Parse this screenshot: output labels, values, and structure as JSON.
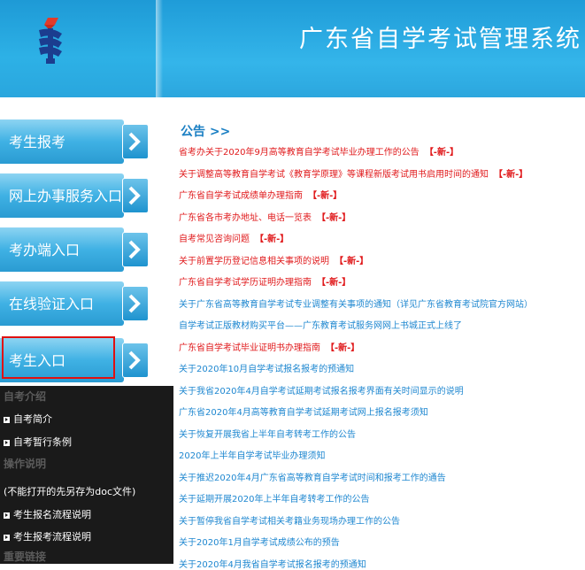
{
  "header": {
    "title": "广东省自学考试管理系统",
    "colors": {
      "bg": "#2aa6dc",
      "text": "#ffffff"
    }
  },
  "sidebar": {
    "buttons": [
      {
        "label": "考生报考"
      },
      {
        "label": "网上办事服务入口"
      },
      {
        "label": "考办端入口"
      },
      {
        "label": "在线验证入口"
      },
      {
        "label": "考生入口",
        "highlighted": true
      }
    ],
    "sections": [
      {
        "heading": "自考介绍",
        "links": [
          "自考简介",
          "自考暂行条例"
        ]
      },
      {
        "heading": "操作说明",
        "note": "(不能打开的先另存为doc文件)",
        "links": [
          "考生报名流程说明",
          "考生报考流程说明"
        ]
      },
      {
        "heading": "重要链接"
      }
    ]
  },
  "notices": {
    "title": "公告 >>",
    "new_tag": "【-新-】",
    "items": [
      {
        "text": "省考办关于2020年9月高等教育自学考试毕业办理工作的公告",
        "color": "red",
        "new": true
      },
      {
        "text": "关于调整高等教育自学考试《教育学原理》等课程新版考试用书启用时间的通知",
        "color": "red",
        "new": true
      },
      {
        "text": "广东省自学考试成绩单办理指南",
        "color": "red",
        "new": true
      },
      {
        "text": "广东省各市考办地址、电话一览表",
        "color": "red",
        "new": true
      },
      {
        "text": "自考常见咨询问题",
        "color": "red",
        "new": true
      },
      {
        "text": "关于前置学历登记信息相关事项的说明",
        "color": "red",
        "new": true
      },
      {
        "text": "广东省自学考试学历证明办理指南",
        "color": "red",
        "new": true
      },
      {
        "text": "关于广东省高等教育自学考试专业调整有关事项的通知（详见广东省教育考试院官方网站）",
        "color": "blue",
        "new": false
      },
      {
        "text": "自学考试正版教材购买平台——广东教育考试服务网网上书城正式上线了",
        "color": "blue",
        "new": false
      },
      {
        "text": "广东省自学考试毕业证明书办理指南",
        "color": "red",
        "new": true
      },
      {
        "text": "关于2020年10月自学考试报名报考的预通知",
        "color": "blue",
        "new": false
      },
      {
        "text": "关于我省2020年4月自学考试延期考试报名报考界面有关时间显示的说明",
        "color": "blue",
        "new": false
      },
      {
        "text": "广东省2020年4月高等教育自学考试延期考试网上报名报考须知",
        "color": "blue",
        "new": false
      },
      {
        "text": "关于恢复开展我省上半年自考转考工作的公告",
        "color": "blue",
        "new": false
      },
      {
        "text": "2020年上半年自学考试毕业办理须知",
        "color": "blue",
        "new": false
      },
      {
        "text": "关于推迟2020年4月广东省高等教育自学考试时间和报考工作的通告",
        "color": "blue",
        "new": false
      },
      {
        "text": "关于延期开展2020年上半年自考转考工作的公告",
        "color": "blue",
        "new": false
      },
      {
        "text": "关于暂停我省自学考试相关考籍业务现场办理工作的公告",
        "color": "blue",
        "new": false
      },
      {
        "text": "关于2020年1月自学考试成绩公布的预告",
        "color": "blue",
        "new": false
      },
      {
        "text": "关于2020年4月我省自学考试报名报考的预通知",
        "color": "blue",
        "new": false
      }
    ]
  },
  "colors": {
    "notice_red": "#e0191b",
    "notice_blue": "#1e87d0",
    "highlight_border": "#e01010"
  }
}
